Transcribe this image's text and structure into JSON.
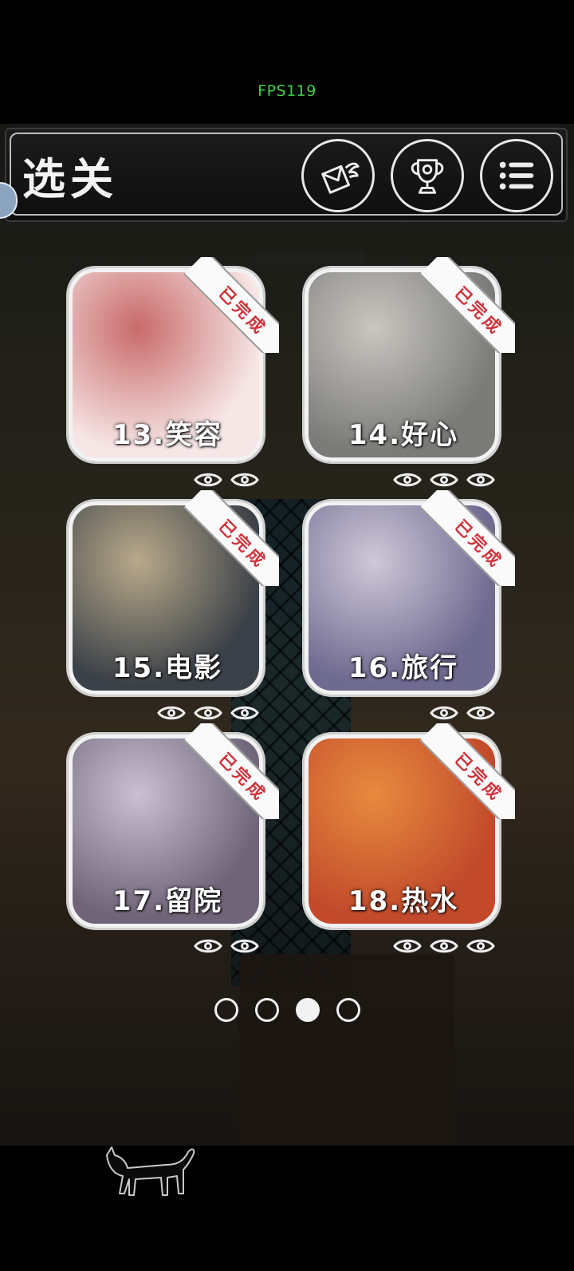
{
  "status": {
    "fps": "FPS119"
  },
  "header": {
    "title": "选关",
    "buttons": [
      {
        "name": "mail-button",
        "icon": "winged-envelope-icon"
      },
      {
        "name": "trophy-button",
        "icon": "trophy-icon"
      },
      {
        "name": "menu-button",
        "icon": "list-menu-icon"
      }
    ]
  },
  "levels": [
    {
      "label": "13.笑容",
      "badge": "已完成",
      "eyes": 2,
      "colors": [
        "#f6e7e6",
        "#c96a6a"
      ]
    },
    {
      "label": "14.好心",
      "badge": "已完成",
      "eyes": 3,
      "colors": [
        "#7b7b78",
        "#c9c6c0"
      ]
    },
    {
      "label": "15.电影",
      "badge": "已完成",
      "eyes": 3,
      "colors": [
        "#3b4148",
        "#b9a98a"
      ]
    },
    {
      "label": "16.旅行",
      "badge": "已完成",
      "eyes": 2,
      "colors": [
        "#6e6a90",
        "#cfc8d8"
      ]
    },
    {
      "label": "17.留院",
      "badge": "已完成",
      "eyes": 2,
      "colors": [
        "#6f6478",
        "#c9c0d2"
      ]
    },
    {
      "label": "18.热水",
      "badge": "已完成",
      "eyes": 3,
      "colors": [
        "#c24a2b",
        "#e78a3e"
      ]
    }
  ],
  "pagination": {
    "pages": 4,
    "current": 3
  }
}
